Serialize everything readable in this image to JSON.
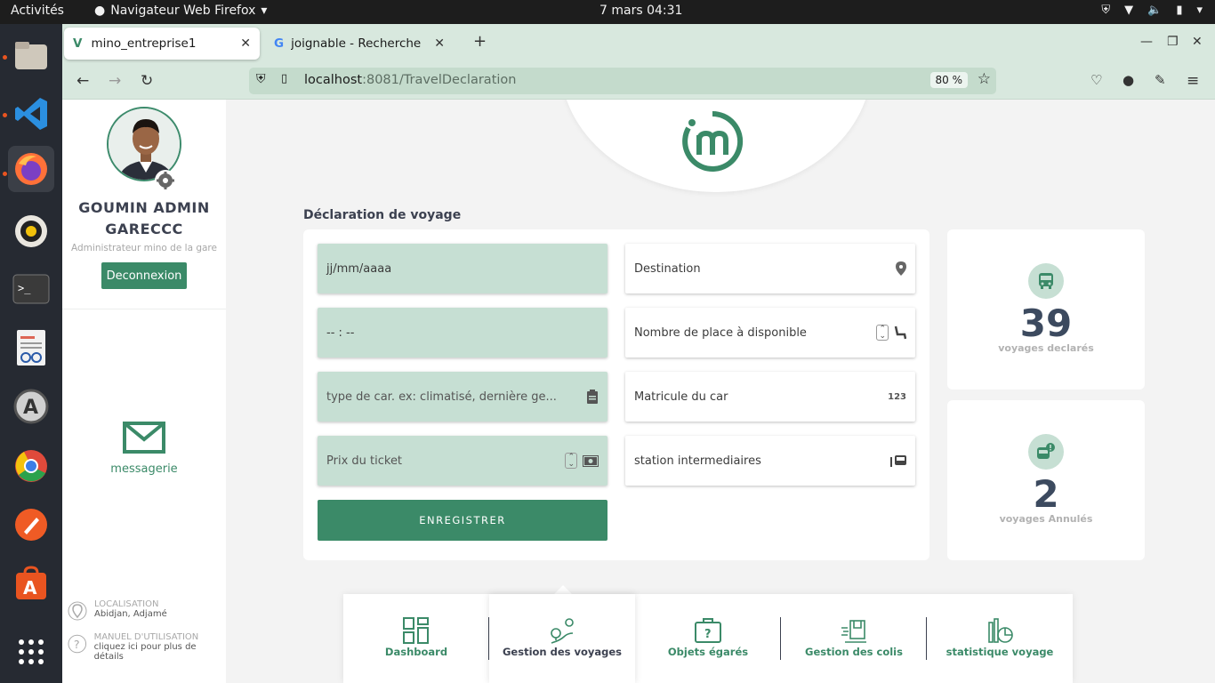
{
  "system": {
    "activities": "Activités",
    "app_name": "Navigateur Web Firefox",
    "clock": "7 mars  04:31"
  },
  "browser": {
    "tabs": [
      {
        "label": "mino_entreprise1",
        "active": true
      },
      {
        "label": "joignable - Recherche Go",
        "active": false
      }
    ],
    "url_host": "localhost",
    "url_path": ":8081/TravelDeclaration",
    "zoom": "80 %"
  },
  "sidebar": {
    "user_name": "GOUMIN ADMIN GARECCC",
    "user_role": "Administrateur mino de la gare",
    "logout_label": "Deconnexion",
    "messaging_label": "messagerie",
    "location_label": "LOCALISATION",
    "location_value": "Abidjan, Adjamé",
    "manual_label": "MANUEL D'UTILISATION",
    "manual_value": "cliquez ici pour plus de détails"
  },
  "form": {
    "title": "Déclaration de voyage",
    "date_value": "jj/mm/aaaa",
    "time_value": "-- : --",
    "car_type_placeholder": "type de car. ex: climatisé, dernière ge...",
    "price_placeholder": "Prix du ticket",
    "destination_placeholder": "Destination",
    "seats_placeholder": "Nombre de place à disponible",
    "plate_placeholder": "Matricule du car",
    "stations_placeholder": "station intermediaires",
    "plate_icon_text": "123",
    "submit_label": "ENREGISTRER"
  },
  "stats": {
    "declared_value": "39",
    "declared_label": "voyages declarés",
    "cancelled_value": "2",
    "cancelled_label": "voyages Annulés"
  },
  "bottom_nav": {
    "items": [
      {
        "label": "Dashboard",
        "icon": "dashboard-icon"
      },
      {
        "label": "Gestion des voyages",
        "icon": "route-icon",
        "active": true
      },
      {
        "label": "Objets égarés",
        "icon": "lost-items-icon"
      },
      {
        "label": "Gestion des colis",
        "icon": "parcel-icon"
      },
      {
        "label": "statistique voyage",
        "icon": "stats-icon"
      }
    ]
  },
  "colors": {
    "brand": "#3b8a68",
    "field_green": "#c6dfd3",
    "browser_chrome": "#d8e8de"
  }
}
